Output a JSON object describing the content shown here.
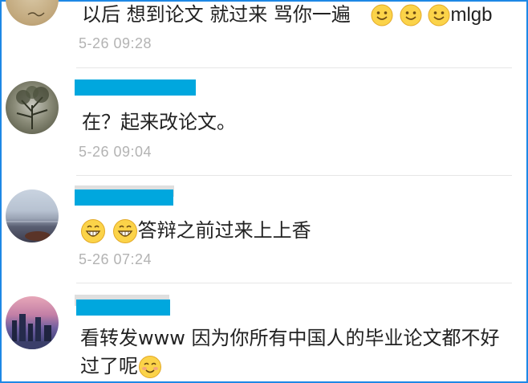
{
  "comments": [
    {
      "text_before": "以后 想到论文 就过来 骂你一遍",
      "text_after": "mlgb",
      "emojis": [
        "smile-emoji",
        "smile-emoji",
        "smile-emoji"
      ],
      "time": "5-26 09:28"
    },
    {
      "text": "在？起来改论文。",
      "time": "5-26 09:04"
    },
    {
      "emojis": [
        "grin-emoji",
        "grin-emoji"
      ],
      "text": "答辩之前过来上上香",
      "time": "5-26 07:24"
    },
    {
      "text_line1": "看转发www 因为你所有中国人的毕业论文都不好",
      "text_line2": "过了呢",
      "emojis": [
        "blush-emoji"
      ]
    }
  ],
  "colors": {
    "frame_border": "#1e88e5",
    "redaction": "#00a7de",
    "timestamp": "#b3b3b3",
    "text": "#222222"
  }
}
